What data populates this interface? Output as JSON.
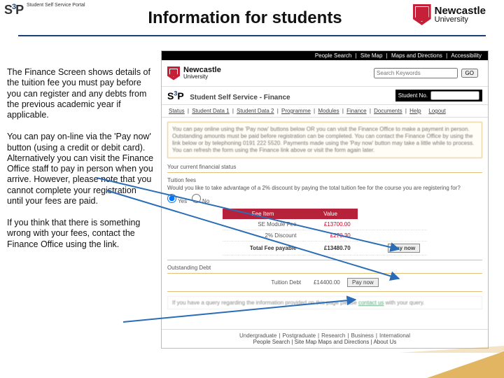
{
  "page_title": "Information for students",
  "s3p_logo": {
    "mark": "S",
    "sup": "3",
    "mark2": "P",
    "sub": "Student\nSelf Service\nPortal"
  },
  "ncl_logo": {
    "line1": "Newcastle",
    "line2": "University"
  },
  "left": {
    "p1": "The Finance Screen shows details of the tuition fee you must pay before you can register and any debts from the previous academic year if applicable.",
    "p2": "You can pay on-line via the 'Pay now' button (using a credit or debit card). Alternatively you can visit the Finance Office staff to pay in person when you arrive.  However, please note that you cannot complete your registration until your fees are paid.",
    "p3": "If you think that there is something wrong with your fees, contact the Finance Office using the link."
  },
  "portal": {
    "topnav": [
      "People Search",
      "Site Map",
      "Maps and Directions",
      "Accessibility"
    ],
    "search_placeholder": "Search Keywords",
    "search_go": "GO",
    "s3p_title": "Student Self Service - Finance",
    "student_no_label": "Student No.",
    "subnav": [
      "Status",
      "Student Data 1",
      "Student Data 2",
      "Programme",
      "Modules",
      "Finance",
      "Documents",
      "Help",
      "Logout"
    ],
    "info_box": "You can pay online using the 'Pay now' buttons below OR you can visit the Finance Office to make a payment in person. Outstanding amounts must be paid before registration can be completed. You can contact the Finance Office by using the link below or by telephoning 0191 222 5520. Payments made using the 'Pay now' button may take a little while to process. You can refresh the form using the Finance link above or visit the form again later.",
    "status_label": "Your current financial status",
    "tuition_label": "Tuition fees",
    "discount_q": "Would you like to take advantage of a 2% discount by paying the total tuition fee for the course you are registering for?",
    "yes": "Yes",
    "no": "No",
    "fee_header_item": "Fee Item",
    "fee_header_value": "Value",
    "fees": [
      {
        "item": "SE Module Fee",
        "value": "£13700.00"
      },
      {
        "item": "2% Discount",
        "value": "£270.30"
      }
    ],
    "total_label": "Total Fee payable",
    "total_value": "£13480.70",
    "outstanding_label": "Outstanding Debt",
    "debt_item": "Tuition Debt",
    "debt_value": "£14400.00",
    "pay_now": "Pay now",
    "query_text": "If you have a query regarding the information provided on this page please ",
    "query_link": "contact us",
    "query_tail": " with your query.",
    "footer_cats": [
      "Undergraduate",
      "Postgraduate",
      "Research",
      "Business",
      "International"
    ],
    "footer_links_pre": "People Search | Site Map ",
    "footer_links_mid": "Maps and Directions",
    "footer_links_post": " | About Us"
  }
}
